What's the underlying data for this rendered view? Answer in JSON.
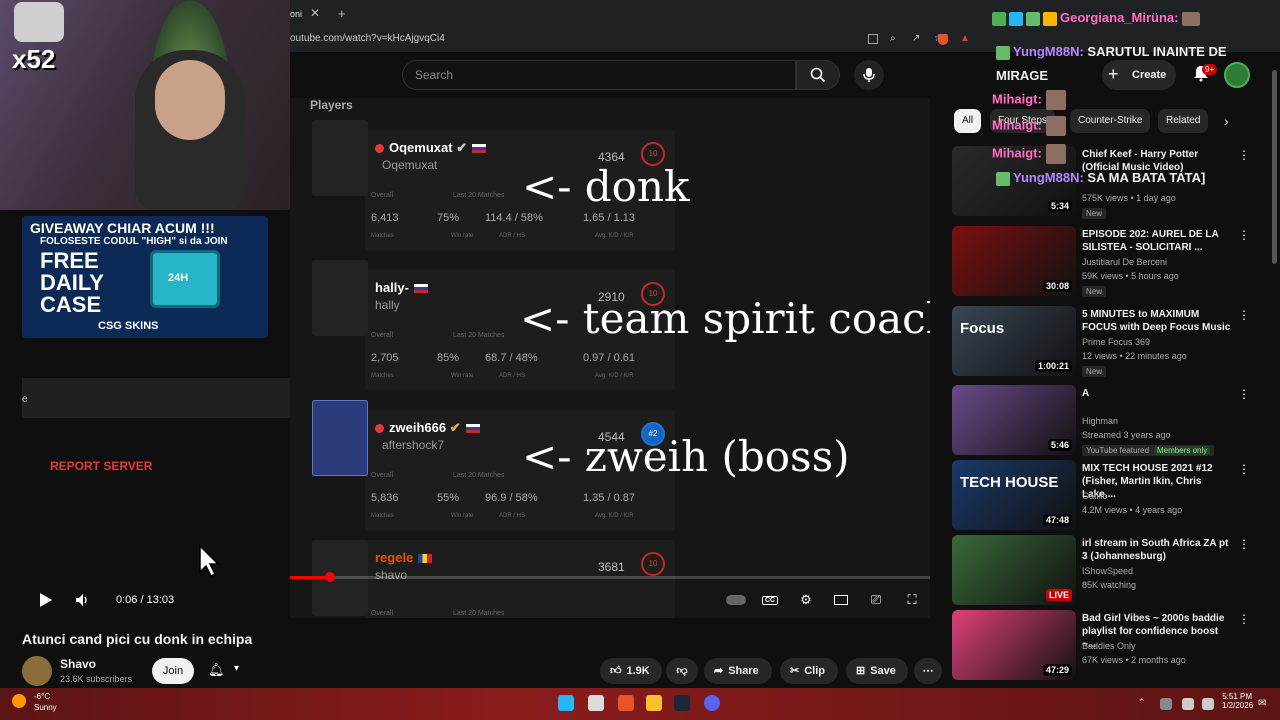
{
  "browser": {
    "tab_label": "oni",
    "url": "outube.com/watch?v=kHcAjgvqCi4"
  },
  "yt_header": {
    "search_placeholder": "Search",
    "create_label": "Create",
    "notif_count": "9+"
  },
  "video": {
    "players_header": "Players",
    "players": [
      {
        "name": "Oqemuxat",
        "sub": "Oqemuxat",
        "elo": "4364",
        "level": "10",
        "matches": "6,413",
        "winrate": "75%",
        "adr_hs": "114.4 / 58%",
        "kd": "1.65 / 1.13"
      },
      {
        "name": "hally-",
        "sub": "hally",
        "elo": "2910",
        "level": "10",
        "matches": "2,705",
        "winrate": "85%",
        "adr_hs": "68.7 / 48%",
        "kd": "0.97 / 0.61"
      },
      {
        "name": "zweih666",
        "sub": "aftershock7",
        "elo": "4544",
        "level": "#2",
        "matches": "5,836",
        "winrate": "55%",
        "adr_hs": "96.9 / 58%",
        "kd": "1.35 / 0.87"
      },
      {
        "name": "regele",
        "sub": "shavo",
        "elo": "3681",
        "level": "10"
      }
    ],
    "stat_labels": {
      "overall": "Overall",
      "last20": "Last 20 Matches"
    },
    "stat_sublabels": {
      "matches": "Matches",
      "winrate": "Win rate",
      "adr": "ADR / HS",
      "kd": "Avg. K/D / K/R"
    },
    "overlays": [
      "<- donk",
      "<- team spirit coach",
      "<- zweih (boss)"
    ],
    "time_current": "0:06",
    "time_sep": " / ",
    "time_total": "13:03",
    "progress_fraction": 0.008,
    "title": "Atunci cand pici cu donk in echipa"
  },
  "channel": {
    "name": "Shavo",
    "subscribers": "23.6K subscribers",
    "join_label": "Join"
  },
  "actions": {
    "likes": "1.9K",
    "share": "Share",
    "clip": "Clip",
    "save": "Save"
  },
  "stream_overlay": {
    "multiplier": "x52",
    "giveaway_line1": "GIVEAWAY CHIAR ACUM !!!",
    "giveaway_line2": "FOLOSESTE CODUL \"HIGH\" si da JOIN",
    "giveaway_free": "FREE DAILY CASE",
    "giveaway_24": "24H",
    "giveaway_brand": "CSG SKINS",
    "report_server": "REPORT SERVER",
    "left_char": "e"
  },
  "chat": [
    {
      "user": "Georgiana_Mirüna:",
      "msg": ""
    },
    {
      "user": "YungM88N:",
      "msg": "SARUTUL INAINTE DE MIRAGE"
    },
    {
      "user": "Mihaigt:",
      "msg": ""
    },
    {
      "user": "Mihaigt:",
      "msg": ""
    },
    {
      "user": "Mihaigt:",
      "msg": ""
    },
    {
      "user": "YungM88N:",
      "msg": "SA MA BATA TATA]"
    }
  ],
  "chips": [
    "All",
    "Four Steps",
    "Counter-Strike",
    "Related"
  ],
  "sidebar_videos": [
    {
      "title": "Chief Keef - Harry Potter (Official Music Video)",
      "channel": "",
      "meta": "575K views • 1 day ago",
      "badge": "New",
      "duration": "5:34",
      "thumb_color": "#2a2a2a"
    },
    {
      "title": "EPISODE 202: AUREL DE LA SILISTEA - SOLICITARI ...",
      "channel": "Justitiarul De Berceni",
      "meta": "59K views • 5 hours ago",
      "badge": "New",
      "duration": "30:08",
      "thumb_color": "#7a1010"
    },
    {
      "title": "5 MINUTES to MAXIMUM FOCUS with Deep Focus Music",
      "channel": "Prime Focus 369",
      "meta": "12 views • 22 minutes ago",
      "badge": "New",
      "duration": "1:00:21",
      "thumb_color": "#3a4654",
      "thumb_text": "Focus"
    },
    {
      "title": "A",
      "channel": "Highman",
      "meta": "Streamed 3 years ago",
      "badge": "YouTube featured",
      "members": "Members only",
      "duration": "5:46",
      "thumb_color": "#6a4a8a"
    },
    {
      "title": "MIX TECH HOUSE 2021 #12 (Fisher, Martin Ikin, Chris Lake,...",
      "channel": "Gatillo",
      "meta": "4.2M views • 4 years ago",
      "duration": "47:48",
      "thumb_color": "#1a3a6a",
      "thumb_text": "TECH HOUSE"
    },
    {
      "title": "irl stream in South Africa ZA pt 3 (Johannesburg)",
      "channel": "IShowSpeed",
      "meta": "85K watching",
      "duration": "LIVE",
      "thumb_color": "#3a6a3a"
    },
    {
      "title": "Bad Girl Vibes ~ 2000s baddie playlist for confidence boost ~...",
      "channel": "Baddies Only",
      "meta": "67K views • 2 months ago",
      "duration": "47:29",
      "thumb_color": "#e0407a"
    }
  ],
  "taskbar": {
    "temp": "-6°C",
    "condition": "Sunny",
    "time": "5:51 PM",
    "date": "1/2/2026"
  },
  "colors": {
    "accent": "#ff0000",
    "bg": "#0f0f0f"
  }
}
